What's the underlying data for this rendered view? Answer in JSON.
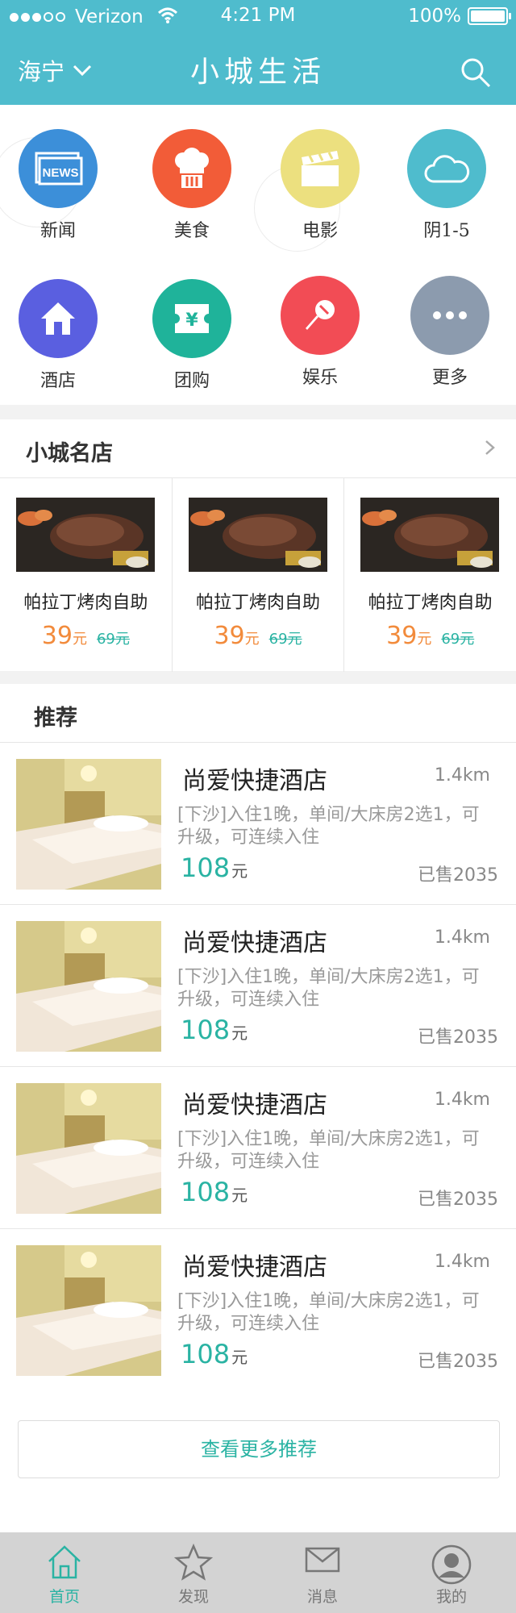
{
  "status_bar": {
    "carrier": "Verizon",
    "time": "4:21 PM",
    "battery": "100%"
  },
  "header": {
    "city": "海宁",
    "title": "小城生活",
    "search_icon": "search-icon"
  },
  "categories": [
    {
      "label": "新闻",
      "icon": "news-icon",
      "color": "#3c8fd9"
    },
    {
      "label": "美食",
      "icon": "chef-hat-icon",
      "color": "#f25c38"
    },
    {
      "label": "电影",
      "icon": "clapperboard-icon",
      "color": "#ece07f"
    },
    {
      "label": "阴1-5",
      "icon": "cloud-icon",
      "color": "#4fbccd"
    },
    {
      "label": "酒店",
      "icon": "house-icon",
      "color": "#5a5fe0"
    },
    {
      "label": "团购",
      "icon": "ticket-icon",
      "color": "#1fb39a"
    },
    {
      "label": "娱乐",
      "icon": "microphone-icon",
      "color": "#f24c55"
    },
    {
      "label": "更多",
      "icon": "more-icon",
      "color": "#8c9bae"
    }
  ],
  "famous_shops": {
    "title": "小城名店",
    "items": [
      {
        "name": "帕拉丁烤肉自助",
        "price": "39",
        "unit": "元",
        "old_price": "69元"
      },
      {
        "name": "帕拉丁烤肉自助",
        "price": "39",
        "unit": "元",
        "old_price": "69元"
      },
      {
        "name": "帕拉丁烤肉自助",
        "price": "39",
        "unit": "元",
        "old_price": "69元"
      }
    ]
  },
  "recommend": {
    "title": "推荐",
    "items": [
      {
        "name": "尚爱快捷酒店",
        "distance": "1.4km",
        "desc": "[下沙]入住1晚，单间/大床房2选1，可升级，可连续入住",
        "price": "108",
        "unit": "元",
        "sold": "已售2035"
      },
      {
        "name": "尚爱快捷酒店",
        "distance": "1.4km",
        "desc": "[下沙]入住1晚，单间/大床房2选1，可升级，可连续入住",
        "price": "108",
        "unit": "元",
        "sold": "已售2035"
      },
      {
        "name": "尚爱快捷酒店",
        "distance": "1.4km",
        "desc": "[下沙]入住1晚，单间/大床房2选1，可升级，可连续入住",
        "price": "108",
        "unit": "元",
        "sold": "已售2035"
      },
      {
        "name": "尚爱快捷酒店",
        "distance": "1.4km",
        "desc": "[下沙]入住1晚，单间/大床房2选1，可升级，可连续入住",
        "price": "108",
        "unit": "元",
        "sold": "已售2035"
      }
    ],
    "more_label": "查看更多推荐"
  },
  "tabbar": [
    {
      "label": "首页",
      "icon": "home-icon",
      "active": true
    },
    {
      "label": "发现",
      "icon": "star-icon",
      "active": false
    },
    {
      "label": "消息",
      "icon": "mail-icon",
      "active": false
    },
    {
      "label": "我的",
      "icon": "user-icon",
      "active": false
    }
  ],
  "colors": {
    "primary": "#4fbccd",
    "accent": "#2ab3a3",
    "price": "#f28b3c"
  }
}
